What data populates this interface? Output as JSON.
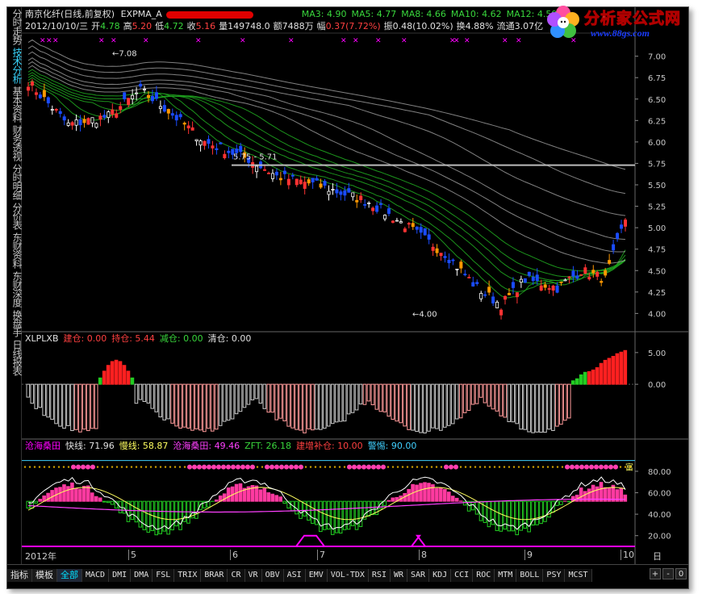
{
  "title": {
    "stock": "南京化纤(日线,前复权)",
    "indicator": "EXPMA_A",
    "ma": [
      {
        "label": "MA3:",
        "value": "4.90"
      },
      {
        "label": "MA5:",
        "value": "4.77"
      },
      {
        "label": "MA8:",
        "value": "4.66"
      },
      {
        "label": "MA10:",
        "value": "4.62"
      },
      {
        "label": "MA12:",
        "value": "4.59"
      }
    ]
  },
  "quote": {
    "date": "2012/10/10/三",
    "open_label": "开",
    "open": "4.78",
    "high_label": "高",
    "high": "5.20",
    "low_label": "低",
    "low": "4.72",
    "close_label": "收",
    "close": "5.16",
    "volume_label": "量",
    "volume": "149748.0",
    "amount_label": "额",
    "amount": "7488万",
    "change_label": "幅",
    "change": "0.37(7.72%)",
    "amp_label": "振",
    "amp": "0.48(10.02%)",
    "turnover_label": "换",
    "turnover": "4.88%",
    "float_label": "流通",
    "float": "3.07亿"
  },
  "sidebar": [
    {
      "label": "分时走势",
      "active": false
    },
    {
      "label": "技术分析",
      "active": true
    },
    {
      "label": "基本资料",
      "active": false
    },
    {
      "label": "财务透视",
      "active": false
    },
    {
      "label": "分时明细",
      "active": false
    },
    {
      "label": "分价表",
      "active": false
    },
    {
      "label": "东财资料",
      "active": false
    },
    {
      "label": "东财深度",
      "active": false
    },
    {
      "label": "换盘手",
      "active": false
    },
    {
      "label": "日线报表",
      "active": false
    }
  ],
  "price_panel": {
    "y_ticks": [
      "7.00",
      "6.75",
      "6.50",
      "6.25",
      "6.00",
      "5.75",
      "5.50",
      "5.25",
      "5.00",
      "4.75",
      "4.50",
      "4.25",
      "4.00"
    ],
    "ylim": [
      3.9,
      7.1
    ],
    "high_mark": "7.08",
    "low_mark": "4.00",
    "box_label": "5.75 - 5.71",
    "ref_line": 5.73
  },
  "mid_panel": {
    "name": "XLPLXB",
    "jian_label": "建仓:",
    "jian": "0.00",
    "chi_label": "持仓:",
    "chi": "5.44",
    "jianc_label": "减仓:",
    "jianc": "0.00",
    "qing_label": "清仓:",
    "qing": "0.00",
    "y_ticks": [
      "5.00",
      "0.00"
    ],
    "ylim": [
      -8,
      6
    ]
  },
  "low_panel": {
    "name": "沧海桑田",
    "fast_label": "快线:",
    "fast": "71.96",
    "slow_label": "慢线:",
    "slow": "58.87",
    "chs_label": "沧海桑田:",
    "chs": "49.46",
    "zft_label": "ZFT:",
    "zft": "26.18",
    "jzbc_label": "建增补仓:",
    "jzbc": "10.00",
    "jt_label": "警惕:",
    "jt": "90.00",
    "fu_label": "富",
    "y_ticks": [
      "80.00",
      "60.00",
      "40.00",
      "20.00"
    ],
    "ylim": [
      10,
      95
    ]
  },
  "date_axis": {
    "year": "2012年",
    "months": [
      "5",
      "6",
      "7",
      "8",
      "9",
      "10"
    ],
    "period": "日线"
  },
  "tabs": [
    {
      "label": "指标",
      "big": true
    },
    {
      "label": "模板",
      "big": true
    },
    {
      "label": "全部",
      "big": true,
      "active": true
    },
    {
      "label": "MACD"
    },
    {
      "label": "DMI"
    },
    {
      "label": "DMA"
    },
    {
      "label": "FSL"
    },
    {
      "label": "TRIX"
    },
    {
      "label": "BRAR"
    },
    {
      "label": "CR"
    },
    {
      "label": "VR"
    },
    {
      "label": "OBV"
    },
    {
      "label": "ASI"
    },
    {
      "label": "EMV"
    },
    {
      "label": "VOL-TDX"
    },
    {
      "label": "RSI"
    },
    {
      "label": "WR"
    },
    {
      "label": "SAR"
    },
    {
      "label": "KDJ"
    },
    {
      "label": "CCI"
    },
    {
      "label": "ROC"
    },
    {
      "label": "MTM"
    },
    {
      "label": "BOLL"
    },
    {
      "label": "PSY"
    },
    {
      "label": "MCST"
    }
  ],
  "scroll": {
    "plus": "+",
    "minus": "-",
    "zero": "0"
  },
  "logo": {
    "brand": "分析家公式网",
    "url": "www.88gs.com"
  },
  "colors": {
    "up": "#ff3333",
    "down": "#1a4cff",
    "ma_green": "#1fa31f",
    "pink": "#ff9a9a",
    "gray": "#c8c8c8",
    "magenta": "#ff00ff",
    "cyan": "#40d0ff"
  }
}
